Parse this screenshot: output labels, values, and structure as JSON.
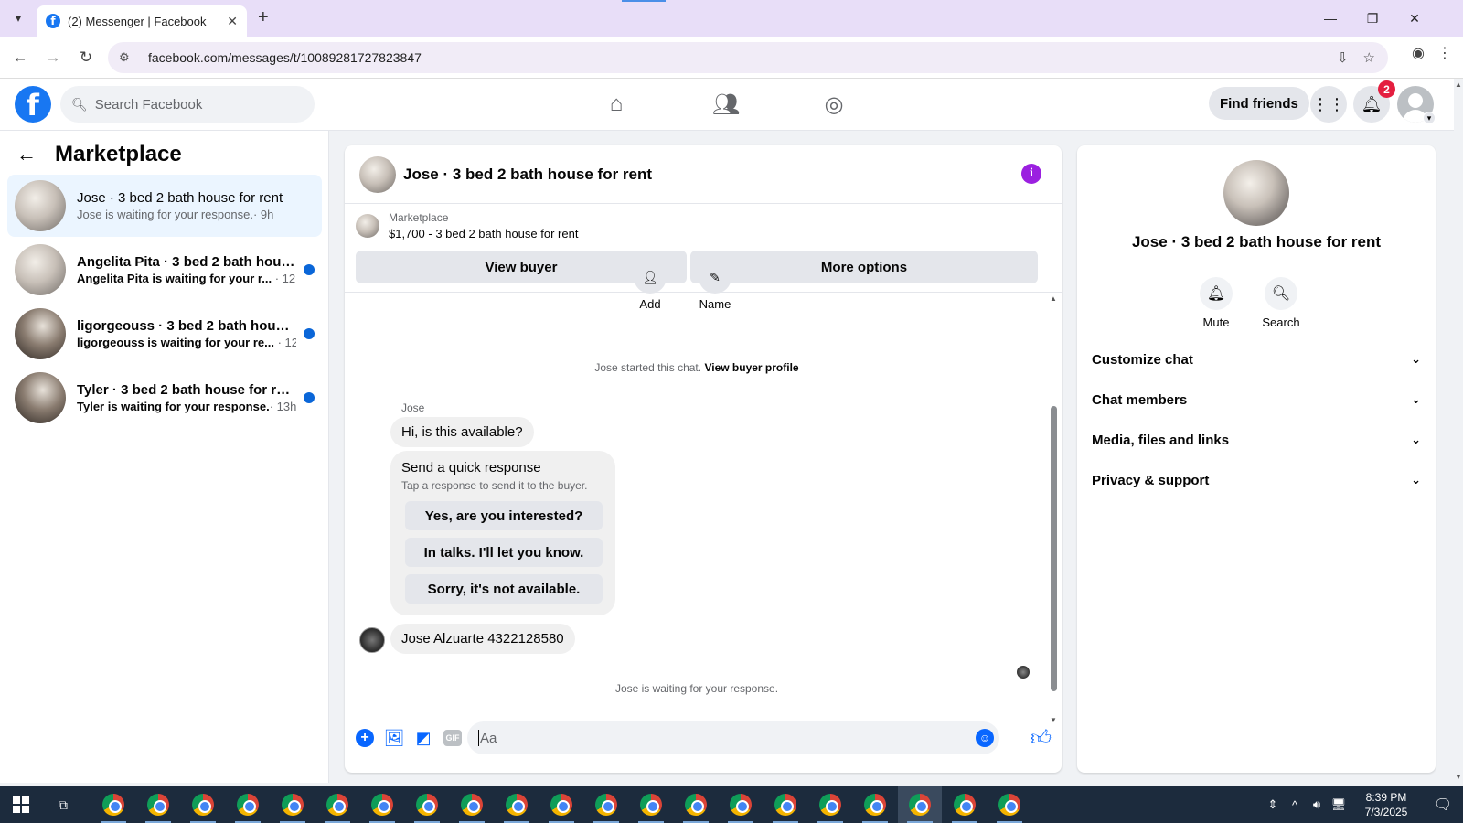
{
  "browser": {
    "tab_title": "(2) Messenger | Facebook",
    "url": "facebook.com/messages/t/10089281727823847"
  },
  "fb": {
    "search_placeholder": "Search Facebook",
    "find_friends": "Find friends",
    "notification_count": "2"
  },
  "sidebar": {
    "title": "Marketplace",
    "conversations": [
      {
        "name": "Jose · 3 bed 2 bath house for rent",
        "preview": "Jose is waiting for your response.",
        "time": "· 9h",
        "active": true,
        "unread": false
      },
      {
        "name": "Angelita Pita · 3 bed 2 bath hous...",
        "preview": "Angelita Pita is waiting for your r...",
        "time": "· 12h",
        "active": false,
        "unread": true
      },
      {
        "name": "ligorgeouss · 3 bed 2 bath house...",
        "preview": "ligorgeouss is waiting for your re...",
        "time": "· 12h",
        "active": false,
        "unread": true
      },
      {
        "name": "Tyler · 3 bed 2 bath house for rent",
        "preview": "Tyler is waiting for your response.",
        "time": "· 13h",
        "active": false,
        "unread": true
      }
    ]
  },
  "chat": {
    "title": "Jose · 3 bed 2 bath house for rent",
    "marketplace_label": "Marketplace",
    "listing": "$1,700 - 3 bed 2 bath house for rent",
    "view_buyer": "View buyer",
    "more_options": "More options",
    "top_actions": {
      "add": "Add",
      "name": "Name"
    },
    "started_text": "Jose started this chat.",
    "view_buyer_profile": "View buyer profile",
    "sender_name": "Jose",
    "msg1": "Hi, is this available?",
    "quick_title": "Send a quick response",
    "quick_subtitle": "Tap a response to send it to the buyer.",
    "quick_responses": [
      "Yes, are you interested?",
      "In talks. I'll let you know.",
      "Sorry, it's not available."
    ],
    "msg2": "Jose Alzuarte 4322128580",
    "waiting_text": "Jose is waiting for your response.",
    "composer_placeholder": "Aa",
    "gif_label": "GIF"
  },
  "info": {
    "name": "Jose · 3 bed 2 bath house for rent",
    "mute": "Mute",
    "search": "Search",
    "rows": [
      "Customize chat",
      "Chat members",
      "Media, files and links",
      "Privacy & support"
    ]
  },
  "taskbar": {
    "time": "8:39 PM",
    "date": "7/3/2025"
  },
  "colors": {
    "fb_blue": "#1877f2",
    "messenger_blue": "#0866ff",
    "active_conv_bg": "#ebf5ff",
    "info_purple": "#9b20e0",
    "badge_red": "#e41e3f",
    "taskbar": "#1c2b3d"
  }
}
